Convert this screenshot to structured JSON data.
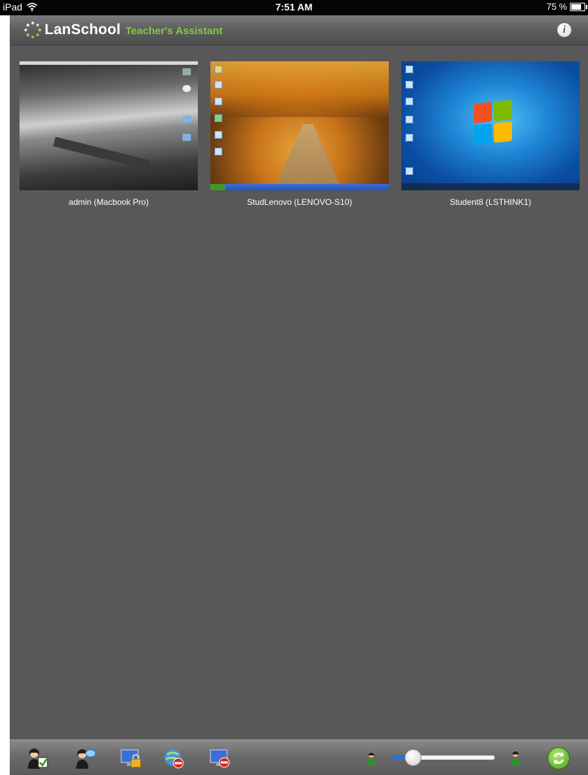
{
  "status_bar": {
    "device": "iPad",
    "time": "7:51 AM",
    "battery": "75 %",
    "battery_level": 0.75
  },
  "header": {
    "brand": "LanSchool",
    "subtitle": "Teacher's Assistant",
    "info_icon": "info-icon"
  },
  "students": [
    {
      "label": "admin (Macbook Pro)",
      "screen": "mac-desktop"
    },
    {
      "label": "StudLenovo (LENOVO-S10)",
      "screen": "xp-desktop"
    },
    {
      "label": "Student8 (LSTHINK1)",
      "screen": "win7-desktop"
    }
  ],
  "toolbar": {
    "buttons": [
      "vote-icon",
      "chat-icon",
      "lock-screen-icon",
      "block-web-icon",
      "blank-screen-icon"
    ],
    "thumbnail_size": 0.2,
    "refresh_icon": "refresh-icon"
  },
  "colors": {
    "accent": "#86c83c",
    "background": "#585858",
    "slider_fill": "#2c6fd6"
  }
}
